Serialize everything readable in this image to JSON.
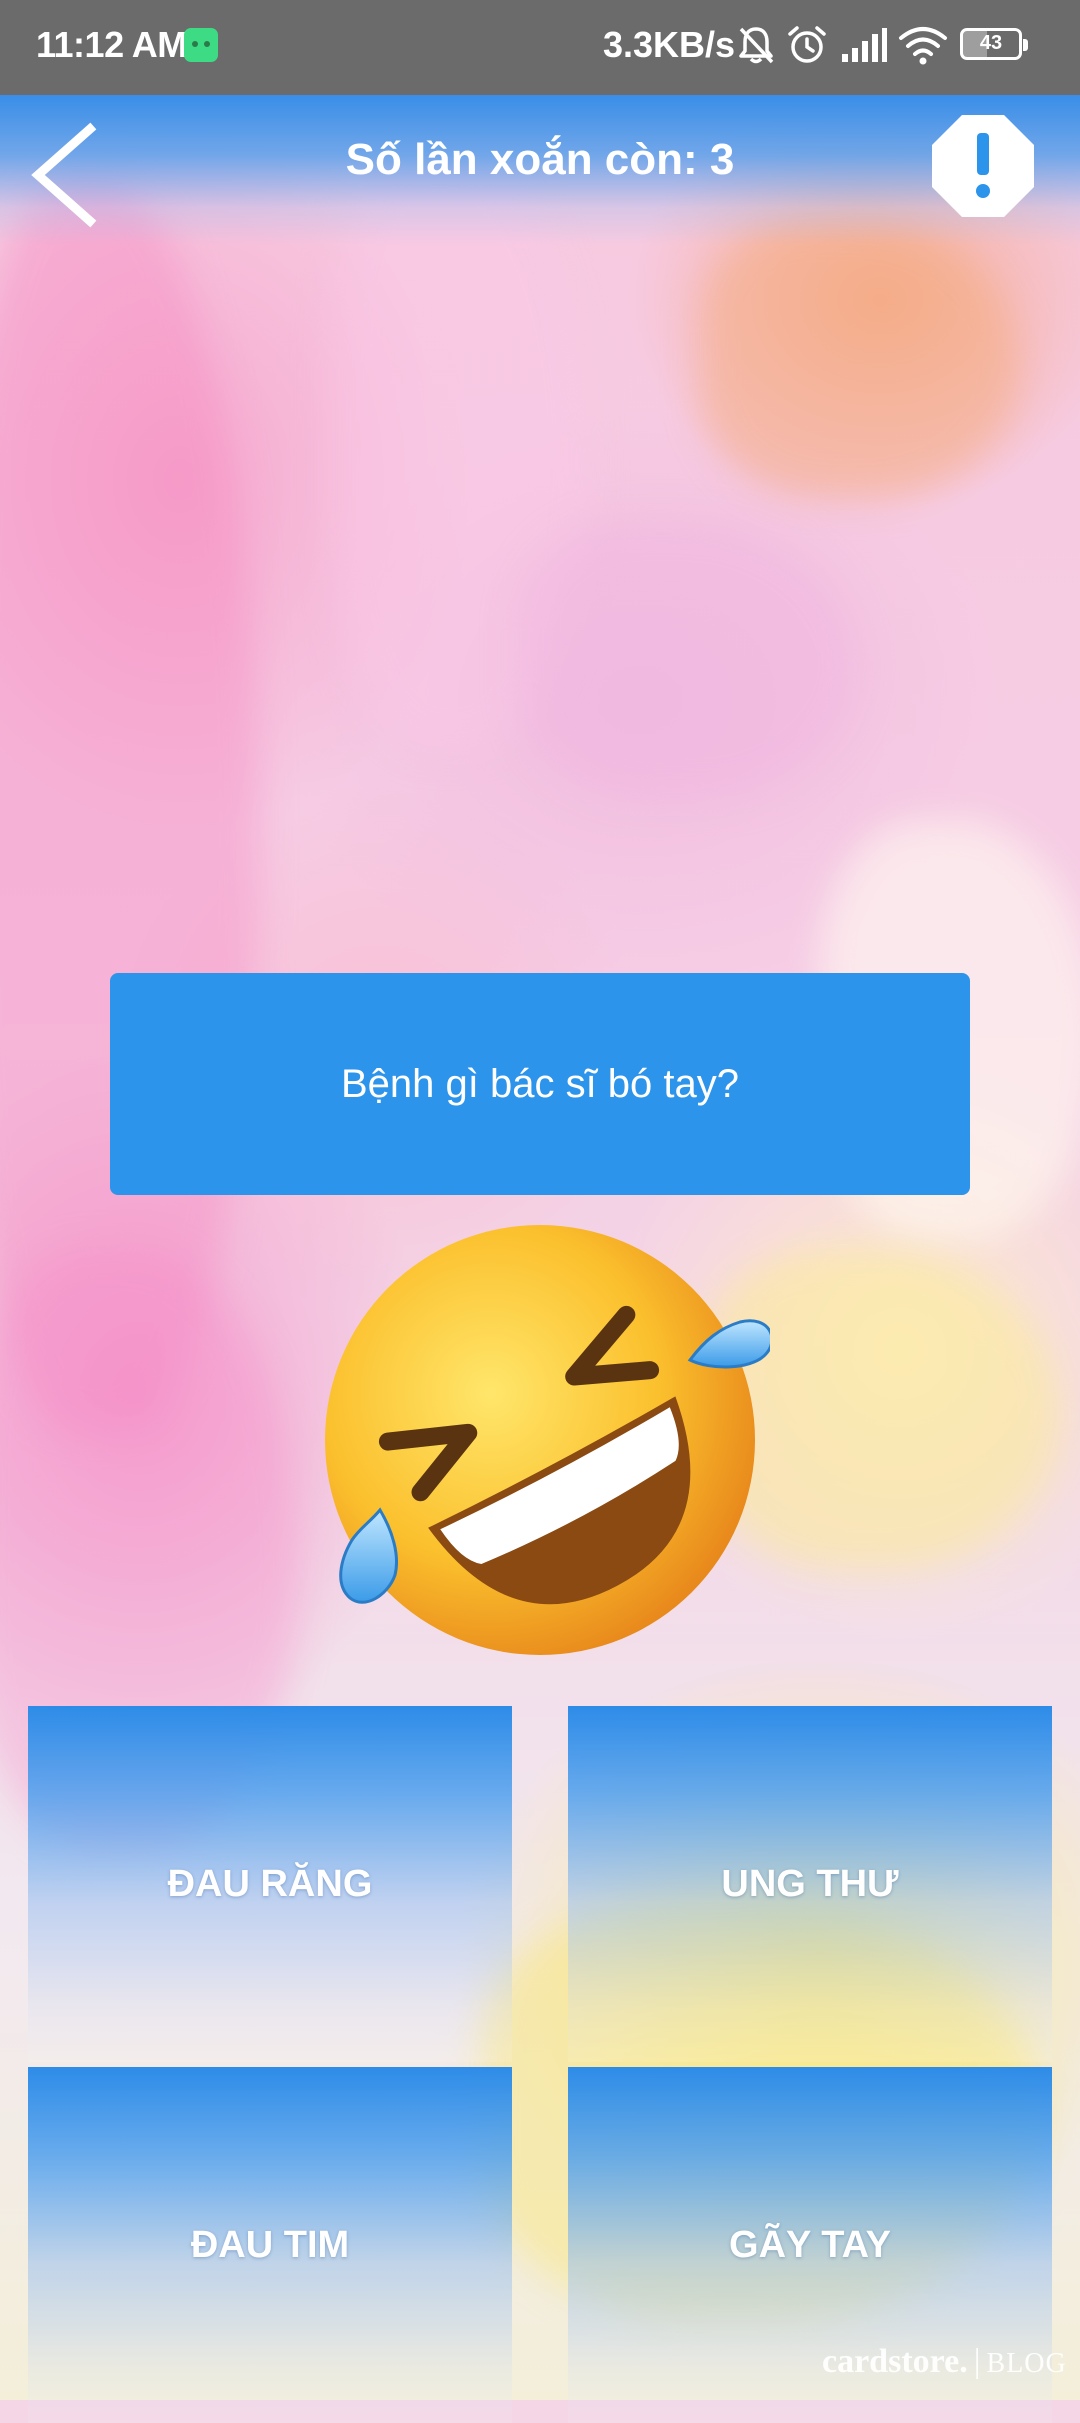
{
  "status_bar": {
    "time": "11:12 AM",
    "network_speed": "3.3KB/s",
    "battery_percent": "43",
    "icons": [
      "app-notification-icon",
      "mute-bell-icon",
      "alarm-icon",
      "signal-icon",
      "wifi-icon",
      "battery-icon"
    ]
  },
  "header": {
    "title": "Số lần xoắn còn: 3",
    "back_icon": "chevron-left-icon",
    "report_icon": "exclamation-octagon-icon"
  },
  "question": {
    "text": "Bệnh gì bác sĩ bó tay?"
  },
  "emoji": {
    "name": "rolling-on-floor-laughing-emoji"
  },
  "answers": [
    {
      "label": "ĐAU RĂNG"
    },
    {
      "label": "UNG THƯ"
    },
    {
      "label": "ĐAU TIM"
    },
    {
      "label": "GÃY TAY"
    }
  ],
  "watermark": {
    "brand": "cardstore.",
    "separator": "|",
    "suffix": "BLOG"
  },
  "colors": {
    "status_bar_bg": "#6b6b6b",
    "accent_blue": "#2d94eb",
    "text_white": "#ffffff"
  }
}
